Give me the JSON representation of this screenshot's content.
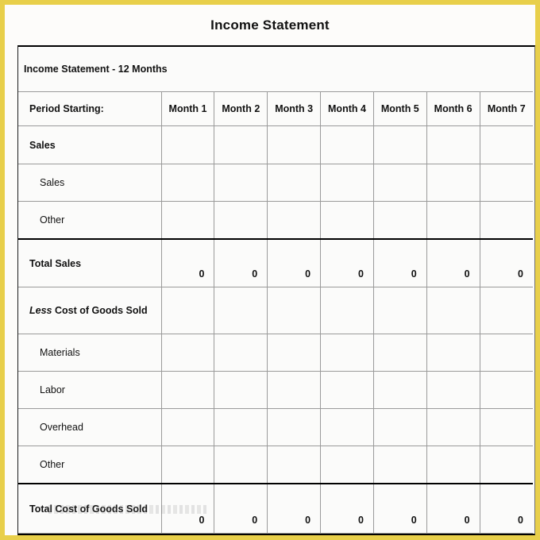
{
  "document": {
    "title": "Income Statement"
  },
  "sheet": {
    "banner_label": "Income Statement - 12 Months",
    "period_label": "Period Starting:",
    "columns": [
      "Month 1",
      "Month 2",
      "Month 3",
      "Month 4",
      "Month 5",
      "Month 6",
      "Month 7"
    ],
    "rows": [
      {
        "kind": "section",
        "label": "Sales",
        "values": [
          "",
          "",
          "",
          "",
          "",
          "",
          ""
        ]
      },
      {
        "kind": "item",
        "label": "Sales",
        "values": [
          "",
          "",
          "",
          "",
          "",
          "",
          ""
        ]
      },
      {
        "kind": "item",
        "label": "Other",
        "values": [
          "",
          "",
          "",
          "",
          "",
          "",
          ""
        ]
      },
      {
        "kind": "total",
        "label": "Total Sales",
        "values": [
          "0",
          "0",
          "0",
          "0",
          "0",
          "0",
          "0"
        ]
      },
      {
        "kind": "section",
        "label_italic": "Less",
        "label": " Cost of Goods Sold",
        "values": [
          "",
          "",
          "",
          "",
          "",
          "",
          ""
        ]
      },
      {
        "kind": "item",
        "label": "Materials",
        "values": [
          "",
          "",
          "",
          "",
          "",
          "",
          ""
        ]
      },
      {
        "kind": "item",
        "label": "Labor",
        "values": [
          "",
          "",
          "",
          "",
          "",
          "",
          ""
        ]
      },
      {
        "kind": "item",
        "label": "Overhead",
        "values": [
          "",
          "",
          "",
          "",
          "",
          "",
          ""
        ]
      },
      {
        "kind": "item",
        "label": "Other",
        "values": [
          "",
          "",
          "",
          "",
          "",
          "",
          ""
        ]
      },
      {
        "kind": "total",
        "label": "Total Cost of Goods Sold",
        "values": [
          "0",
          "0",
          "0",
          "0",
          "0",
          "0",
          "0"
        ]
      }
    ]
  },
  "colors": {
    "banner_gold": "#988f52",
    "page_border_yellow": "#e8cf4a",
    "cell_background": "#fbfbfa",
    "grid_line": "#9a9a9a",
    "heavy_rule": "#000000",
    "text": "#111111"
  }
}
